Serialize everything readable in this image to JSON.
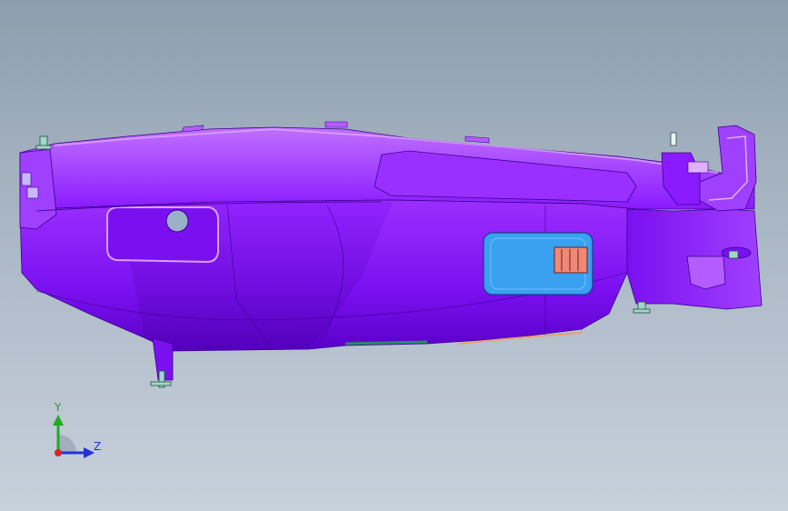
{
  "viewport": {
    "background_top": "#8e9eb0",
    "background_bottom": "#c7d1dc"
  },
  "model": {
    "body_color": "#8a1aff",
    "body_dark": "#5a00c8",
    "body_light": "#b45cff",
    "highlight": "#d9a0ff",
    "window_color": "#3aa0f0",
    "connector_color": "#f08878",
    "fastener_color": "#9fd8c8"
  },
  "triad": {
    "y_label": "Y",
    "z_label": "Z",
    "y_color": "#22aa22",
    "z_color": "#2233dd",
    "x_color": "#dd2222"
  }
}
